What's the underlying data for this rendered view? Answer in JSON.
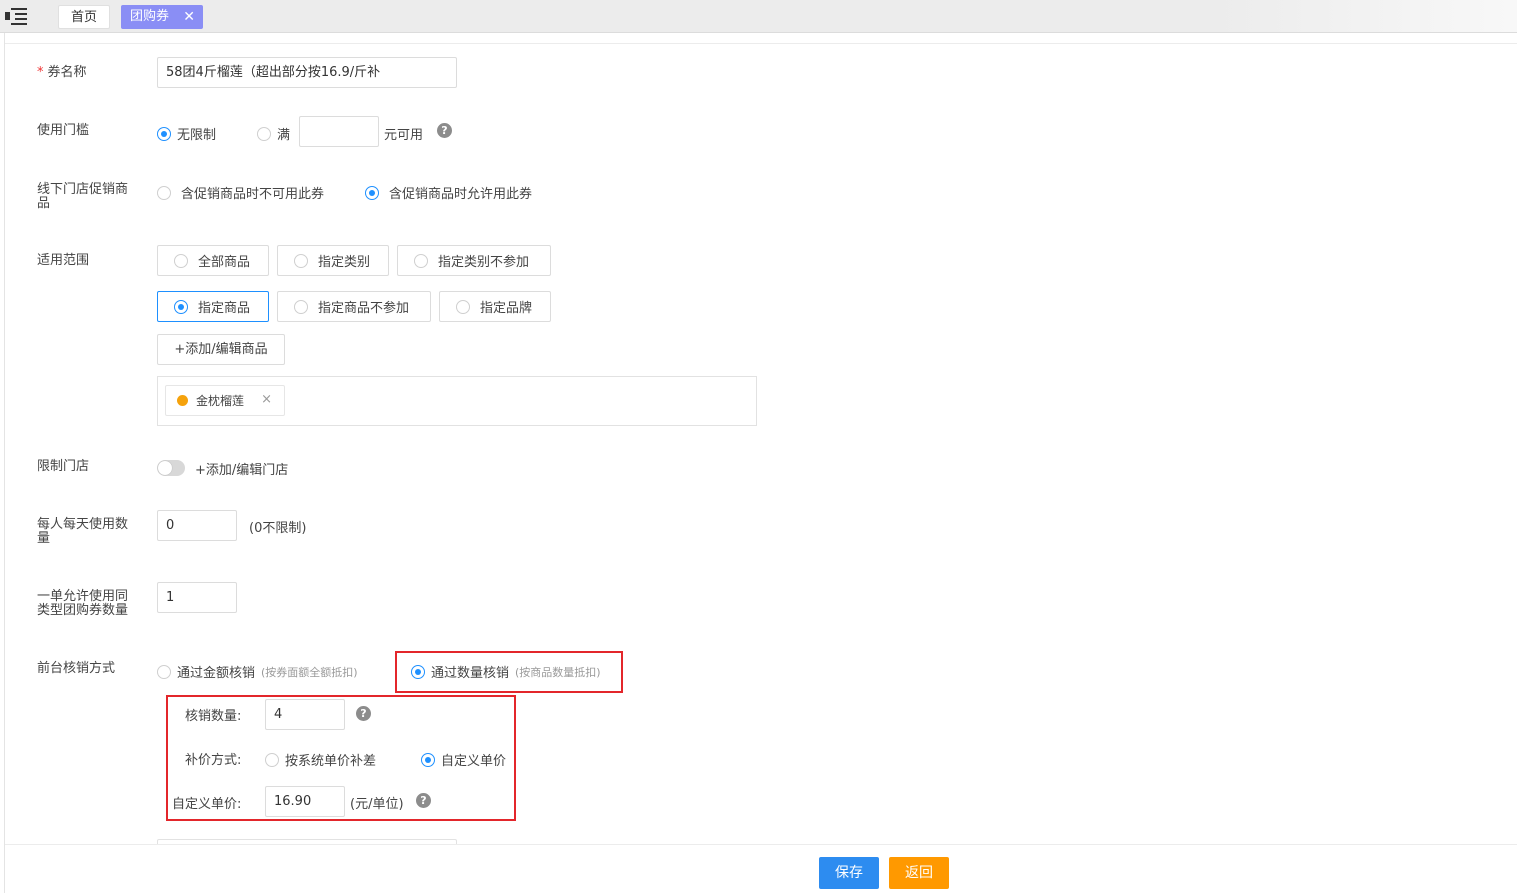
{
  "tabs": [
    {
      "label": "首页"
    },
    {
      "label": "团购券",
      "close": "✕"
    }
  ],
  "form": {
    "name": {
      "label": "券名称",
      "required_mark": "*",
      "value": "58团4斤榴莲（超出部分按16.9/斤补"
    },
    "threshold": {
      "label": "使用门槛",
      "opt_unlimited": "无限制",
      "opt_full": "满",
      "amount_value": "",
      "suffix": "元可用"
    },
    "offline_promo": {
      "label": "线下门店促销商品",
      "opt_disallow": "含促销商品时不可用此券",
      "opt_allow": "含促销商品时允许用此券"
    },
    "scope": {
      "label": "适用范围",
      "options": [
        "全部商品",
        "指定类别",
        "指定类别不参加",
        "指定商品",
        "指定商品不参加",
        "指定品牌"
      ],
      "selected": "指定商品",
      "add_button": "+添加/编辑商品",
      "products": [
        {
          "name": "金枕榴莲",
          "remove": "×"
        }
      ]
    },
    "store_limit": {
      "label": "限制门店",
      "toggle_on": false,
      "add_link": "+添加/编辑门店"
    },
    "daily_limit": {
      "label": "每人每天使用数量",
      "value": "0",
      "hint": "(0不限制)"
    },
    "per_order": {
      "label": "一单允许使用同类型团购券数量",
      "value": "1"
    },
    "redeem": {
      "label": "前台核销方式",
      "opt_amount": "通过金额核销",
      "opt_amount_hint": "(按券面额全额抵扣)",
      "opt_quantity": "通过数量核销",
      "opt_quantity_hint": "(按商品数量抵扣)",
      "qty_label": "核销数量:",
      "qty_value": "4",
      "comp_label": "补价方式:",
      "comp_system": "按系统单价补差",
      "comp_custom": "自定义单价",
      "unit_label": "自定义单价:",
      "unit_value": "16.90",
      "unit_suffix": "(元/单位)"
    }
  },
  "footer": {
    "save": "保存",
    "back": "返回"
  },
  "colors": {
    "accent": "#2d8cf0",
    "radio": "#1e90ff",
    "back": "#ff9900",
    "tab_active": "#8a8ef5",
    "highlight": "#e3262b"
  },
  "help_icon": "?"
}
